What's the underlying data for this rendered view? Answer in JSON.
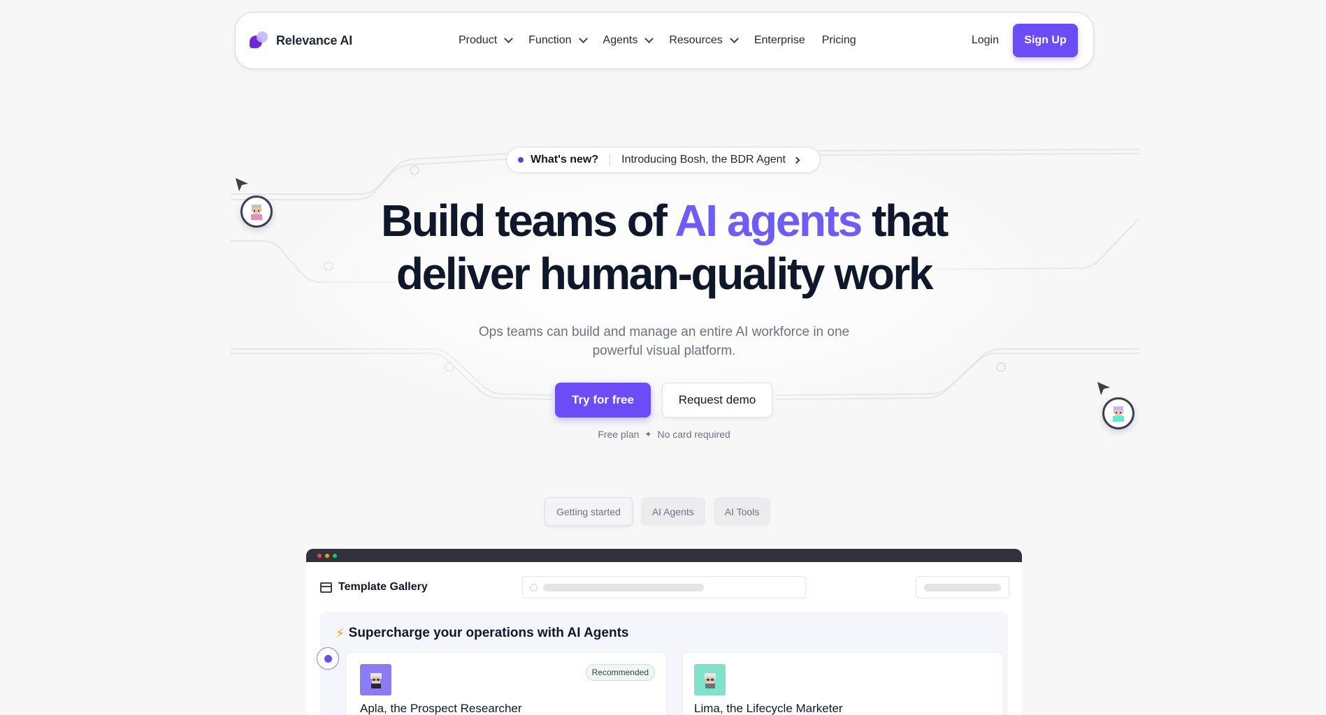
{
  "nav": {
    "brand": "Relevance AI",
    "links": [
      {
        "label": "Product",
        "has_dropdown": true
      },
      {
        "label": "Function",
        "has_dropdown": true
      },
      {
        "label": "Agents",
        "has_dropdown": true
      },
      {
        "label": "Resources",
        "has_dropdown": true
      },
      {
        "label": "Enterprise",
        "has_dropdown": false
      },
      {
        "label": "Pricing",
        "has_dropdown": false
      }
    ],
    "login": "Login",
    "signup": "Sign Up"
  },
  "announcement": {
    "label": "What's new?",
    "text": "Introducing Bosh, the BDR Agent"
  },
  "hero": {
    "headline_part1": "Build teams of ",
    "headline_accent": "AI agents",
    "headline_part2": " that",
    "headline_line2": "deliver human-quality work",
    "subtext": "Ops teams can build and manage an entire AI workforce in one powerful visual platform.",
    "cta_primary": "Try for free",
    "cta_secondary": "Request demo",
    "fine_print_1": "Free plan",
    "fine_print_sep": "✦",
    "fine_print_2": "No card required"
  },
  "tabs": [
    {
      "label": "Getting started",
      "active": true
    },
    {
      "label": "AI Agents",
      "active": false
    },
    {
      "label": "AI Tools",
      "active": false
    }
  ],
  "gallery": {
    "title": "Template Gallery",
    "section_title": "Supercharge your operations with AI Agents",
    "section_icon": "lightning-icon",
    "cards": [
      {
        "name": "Apla, the Prospect Researcher",
        "badge": "Recommended",
        "avatar_color": "#8b7cf6"
      },
      {
        "name": "Lima, the Lifecycle Marketer",
        "badge": "",
        "avatar_color": "#7fe3c9"
      }
    ]
  },
  "colors": {
    "accent": "#6b4cf6",
    "headline_accent": "#6d5cf5",
    "window_bar": "#32323c"
  }
}
